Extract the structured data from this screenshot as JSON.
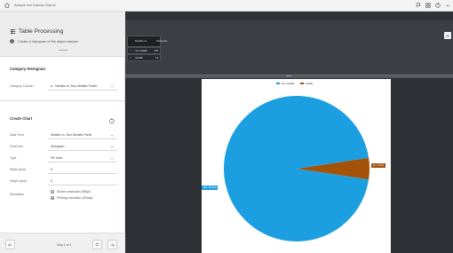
{
  "window": {
    "title": "Analyze and Classify Objects"
  },
  "header": {
    "title": "Table Processing",
    "description": "Create a histogram of the object classes"
  },
  "category_section": {
    "title": "Category Histogram",
    "row_label": "Category Column",
    "row_value": "A - Metallic vs. Non-Metallic Particl..."
  },
  "chart_section": {
    "title": "Create Chart",
    "rows": [
      {
        "label": "Data From",
        "value": "Metallic vs. Non-Metallic Partic"
      },
      {
        "label": "Chart Into",
        "value": "Histogram"
      },
      {
        "label": "Type",
        "value": "Pie chart"
      },
      {
        "label": "Width (inch)",
        "value": "5"
      },
      {
        "label": "Height (inch)",
        "value": "5"
      }
    ],
    "resolution_label": "Resolution",
    "resolution_options": [
      {
        "label": "Screen resolution (96dpi)",
        "selected": false
      },
      {
        "label": "Printing resolution (300dpi)",
        "selected": true
      }
    ]
  },
  "footer": {
    "page_text": "Step 1 of 1"
  },
  "table": {
    "columns": [
      "Metallic vs. Non-Metallic Partic...",
      "Histogram"
    ],
    "header_short": [
      "Metallic vs.",
      "Histogram"
    ],
    "rows": [
      {
        "index": "1",
        "name": "non-metallic",
        "value": "278"
      },
      {
        "index": "2",
        "name": "metallic",
        "value": "14"
      }
    ]
  },
  "chart_data": {
    "type": "pie",
    "categories": [
      "non-metallic",
      "metallic"
    ],
    "values": [
      278,
      14
    ],
    "percent_labels": [
      "278 - 95.21%",
      "14 - 4.79%"
    ],
    "colors": [
      "#1c9fe0",
      "#a4520a"
    ],
    "legend_position": "top-center"
  },
  "colors": {
    "accent": "#1c9fe0",
    "metallic": "#a4520a",
    "dark_bg": "#2f3237"
  }
}
